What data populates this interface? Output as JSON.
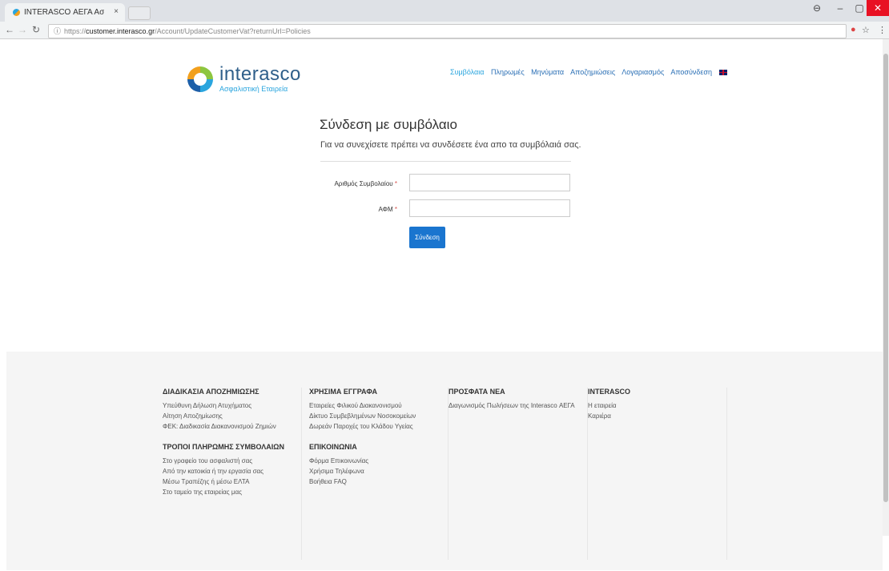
{
  "browser": {
    "tab_title": "INTERASCO ΑΕΓΑ Ασφαλ",
    "tab_close": "×",
    "url_prefix": "https://",
    "url_host": "customer.interasco.gr",
    "url_path": "/Account/UpdateCustomerVat?returnUrl=Policies",
    "info_icon": "ⓘ"
  },
  "logo": {
    "name": "interasco",
    "subtitle": "Ασφαλιστική Εταιρεία"
  },
  "nav": {
    "items": [
      "Συμβόλαια",
      "Πληρωμές",
      "Μηνύματα",
      "Αποζημιώσεις",
      "Λογαριασμός",
      "Αποσύνδεση"
    ]
  },
  "form": {
    "title": "Σύνδεση με συμβόλαιο",
    "subtitle": "Για να συνεχίσετε πρέπει να συνδέσετε ένα απο τα συμβόλαιά σας.",
    "contract_label": "Αριθμός Συμβολαίου",
    "vat_label": "ΑΦΜ",
    "required_mark": "*",
    "contract_value": "",
    "vat_value": "",
    "submit_label": "Σύνδεση"
  },
  "footer": {
    "col1": {
      "heading": "ΔΙΑΔΙΚΑΣΙΑ ΑΠΟΖΗΜΙΩΣΗΣ",
      "items": [
        "Υπεύθυνη Δήλωση Ατυχήματος",
        "Αίτηση Αποζημίωσης",
        "ΦΕΚ: Διαδικασία Διακανονισμού Ζημιών"
      ],
      "heading2": "ΤΡΟΠΟΙ ΠΛΗΡΩΜΗΣ ΣΥΜΒΟΛΑΙΩΝ",
      "items2": [
        "Στο γραφείο του ασφαλιστή σας",
        "Από την κατοικία ή την εργασία σας",
        "Μέσω Τραπέζης ή μέσω ΕΛΤΑ",
        "Στο ταμείο της εταιρείας μας"
      ]
    },
    "col2": {
      "heading": "ΧΡΗΣΙΜΑ ΕΓΓΡΑΦΑ",
      "items": [
        "Εταιρείες Φιλικού Διακανονισμού",
        "Δίκτυο Συμβεβλημένων Νοσοκομείων",
        "Δωρεάν Παροχές του Κλάδου Υγείας"
      ],
      "heading2": "ΕΠΙΚΟΙΝΩΝΙΑ",
      "items2": [
        "Φόρμα Επικοινωνίας",
        "Χρήσιμα Τηλέφωνα",
        "Βοήθεια FAQ"
      ]
    },
    "col3": {
      "heading": "ΠΡΟΣΦΑΤΑ ΝΕΑ",
      "items": [
        "Διαγωνισμός Πωλήσεων της Interasco ΑΕΓΑ"
      ]
    },
    "col4": {
      "heading": "INTERASCO",
      "items": [
        "Η εταιρεία",
        "Καριέρα"
      ]
    }
  },
  "colors": {
    "accent": "#2aa5de",
    "button": "#1a75cf",
    "footer_bg": "#f5f5f5"
  }
}
